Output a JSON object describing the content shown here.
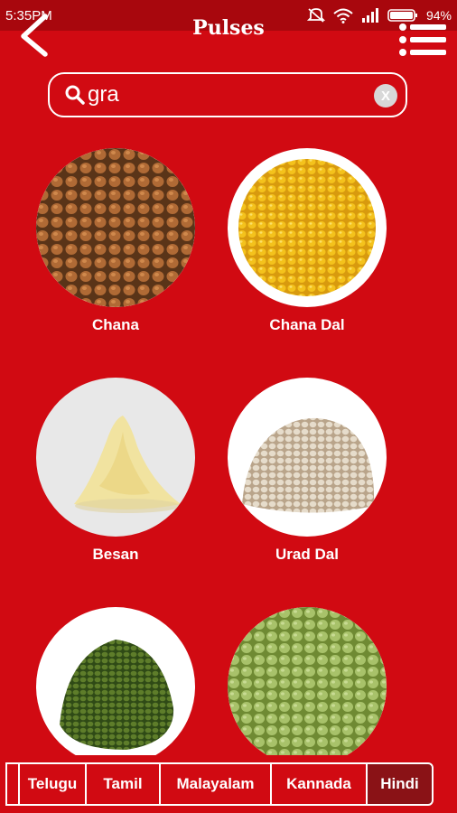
{
  "status_bar": {
    "time": "5:35PM",
    "battery": "94%"
  },
  "header": {
    "title": "Pulses"
  },
  "search": {
    "value": "gra",
    "clear_label": "X"
  },
  "items": [
    {
      "label": "Chana",
      "image": "chickpeas"
    },
    {
      "label": "Chana Dal",
      "image": "yellow-split-pulses"
    },
    {
      "label": "Besan",
      "image": "gram-flour"
    },
    {
      "label": "Urad Dal",
      "image": "white-split-lentils"
    },
    {
      "label": "",
      "image": "green-moong"
    },
    {
      "label": "",
      "image": "green-split-peas"
    }
  ],
  "languages": {
    "tabs": [
      "Telugu",
      "Tamil",
      "Malayalam",
      "Kannada",
      "Hindi"
    ],
    "active": "Hindi"
  },
  "colors": {
    "background": "#d10a12",
    "status_bar": "#a8070d",
    "active_tab": "#8a1216"
  }
}
